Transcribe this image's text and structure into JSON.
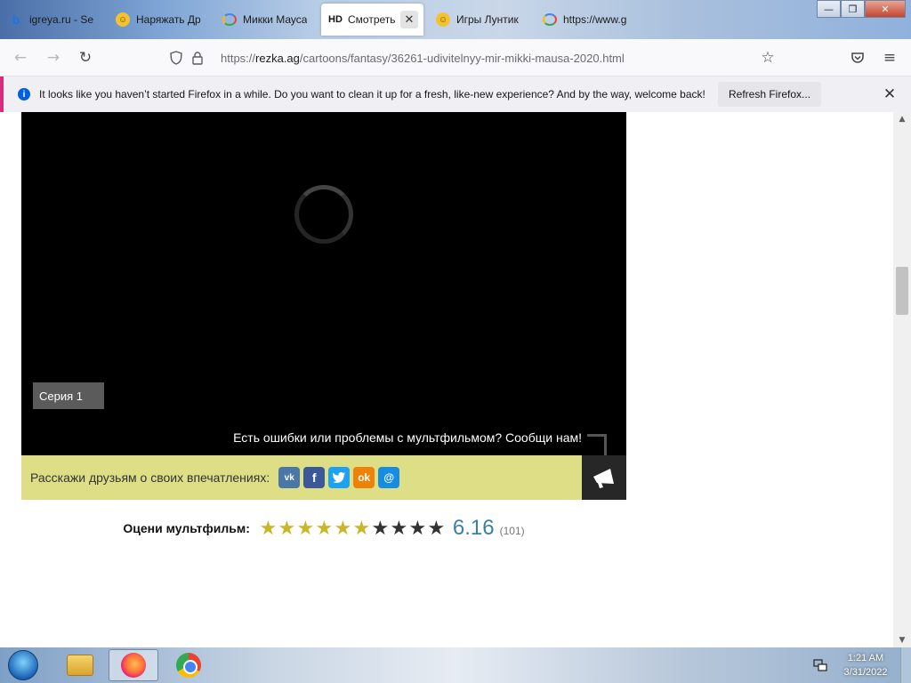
{
  "browser": {
    "tabs": [
      {
        "title": "igreya.ru - Se",
        "favicon": "bing-icon",
        "active": false
      },
      {
        "title": "Наряжать Др",
        "favicon": "kid-icon",
        "active": false
      },
      {
        "title": "Микки Мауса",
        "favicon": "google-icon",
        "active": false
      },
      {
        "badge": "HD",
        "title": "Смотреть",
        "favicon": "hd-icon",
        "active": true,
        "close_glyph": "✕"
      },
      {
        "title": "Игры Лунтик",
        "favicon": "kid-icon",
        "active": false
      },
      {
        "title": "https://www.g",
        "favicon": "google-icon",
        "active": false
      }
    ],
    "window_controls": {
      "minimize": "—",
      "restore": "❐",
      "close": "✕"
    },
    "nav": {
      "back": "←",
      "forward": "→",
      "reload": "↻"
    },
    "url": {
      "prefix": "https://",
      "host": "rezka.ag",
      "path": "/cartoons/fantasy/36261-udivitelnyy-mir-mikki-mausa-2020.html"
    },
    "toolbar": {
      "bookmark": "☆",
      "pocket": "◡",
      "menu": "≡"
    }
  },
  "notification": {
    "info_glyph": "i",
    "text": "It looks like you haven’t started Firefox in a while. Do you want to clean it up for a fresh, like-new experience? And by the way, welcome back!",
    "button_label": "Refresh Firefox...",
    "close_glyph": "✕"
  },
  "player": {
    "episode_label": "Серия 1",
    "report_text": "Есть ошибки или проблемы с мультфильмом? Сообщи нам!"
  },
  "share": {
    "label": "Расскажи друзьям о своих впечатлениях:",
    "networks": [
      {
        "name": "vk",
        "glyph": "vk"
      },
      {
        "name": "facebook",
        "glyph": "f"
      },
      {
        "name": "twitter",
        "glyph": "t"
      },
      {
        "name": "odnoklassniki",
        "glyph": "ok"
      },
      {
        "name": "mailru",
        "glyph": "@"
      }
    ]
  },
  "rating": {
    "label": "Оцени мультфильм:",
    "stars_total": 10,
    "stars_filled": 6,
    "value": "6.16",
    "count": "(101)"
  },
  "taskbar": {
    "clock_time": "1:21 AM",
    "clock_date": "3/31/2022"
  },
  "colors": {
    "share_bg": "#dede87",
    "star_on": "#c9b62a",
    "rating_value": "#3a7fa8",
    "notify_accent": "#d92b7b"
  }
}
